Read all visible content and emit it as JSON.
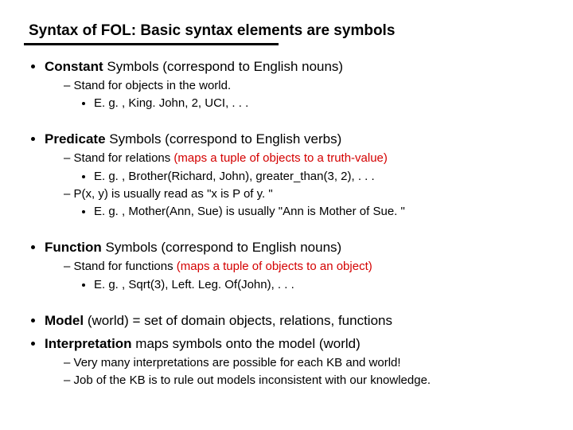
{
  "title": "Syntax of FOL: Basic syntax elements are symbols",
  "sections": [
    {
      "head_bold": "Constant",
      "head_rest": " Symbols (correspond to English nouns)",
      "subs": [
        {
          "text": "Stand for objects in the world.",
          "eg": "E. g. , King. John, 2, UCI, . . ."
        }
      ]
    },
    {
      "head_bold": "Predicate",
      "head_rest": " Symbols (correspond to English verbs)",
      "subs": [
        {
          "text": "Stand for relations ",
          "red": "(maps a tuple of objects to a truth-value)",
          "eg": "E. g. , Brother(Richard, John), greater_than(3, 2), . . ."
        },
        {
          "text": "P(x, y) is usually read as \"x is P of y. \"",
          "eg": "E. g. , Mother(Ann, Sue) is usually \"Ann is Mother of Sue. \""
        }
      ]
    },
    {
      "head_bold": "Function",
      "head_rest": " Symbols (correspond to English nouns)",
      "subs": [
        {
          "text": "Stand for functions ",
          "red": "(maps a tuple of objects to an object)",
          "eg": "E. g. , Sqrt(3), Left. Leg. Of(John), . . ."
        }
      ]
    }
  ],
  "tail": {
    "model_bold": "Model",
    "model_rest": " (world) = set of domain objects, relations, functions",
    "interp_bold": "Interpretation",
    "interp_rest": " maps symbols onto the model (world)",
    "notes": [
      "Very many interpretations are possible for each KB and world!",
      "Job of the KB is to rule out models inconsistent with our knowledge."
    ]
  }
}
